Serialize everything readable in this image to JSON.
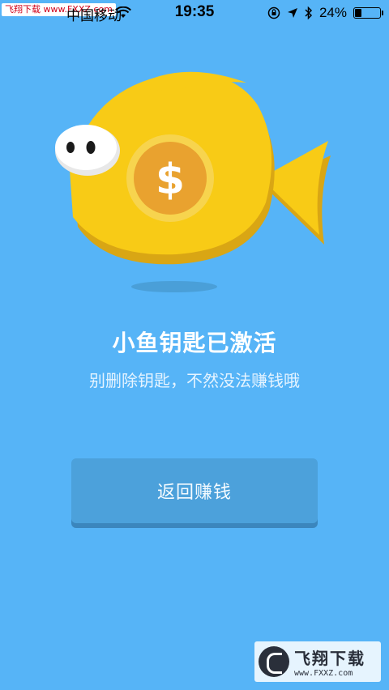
{
  "status_bar": {
    "watermark": "飞翔下载 www.FXXZ.com",
    "carrier": "中国移动",
    "time": "19:35",
    "battery_percent": "24%",
    "battery_level": 0.24,
    "icons": [
      "wifi-icon",
      "orientation-lock-icon",
      "location-icon",
      "bluetooth-icon",
      "battery-icon"
    ]
  },
  "illustration": {
    "icon": "fish-coin-icon",
    "coin_symbol": "$",
    "colors": {
      "fish_body": "#f8cb16",
      "fish_shadow": "#d9a614",
      "coin_ring": "#f7d44e",
      "coin_center": "#e9a22f"
    }
  },
  "main": {
    "title": "小鱼钥匙已激活",
    "subtitle": "别删除钥匙，不然没法赚钱哦",
    "return_button_label": "返回赚钱"
  },
  "watermark": {
    "brand_cn": "飞翔下载",
    "brand_url": "www.FXXZ.com"
  },
  "colors": {
    "background": "#56b4f7",
    "button": "#4ca1db"
  }
}
